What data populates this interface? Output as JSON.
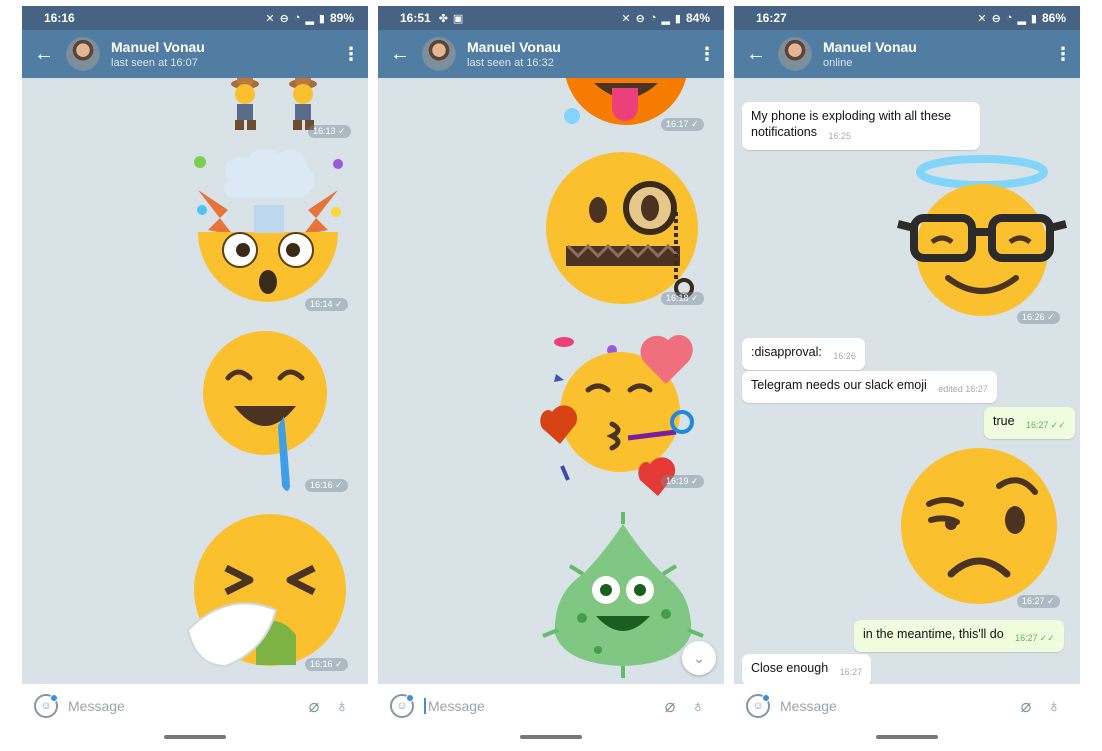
{
  "colors": {
    "header": "#527da3",
    "statusbar": "#466384",
    "chat_bg": "#d8e2e7",
    "outgoing_bubble": "#effdde",
    "emoji_yellow": "#fbc02d"
  },
  "screens": [
    {
      "status": {
        "time": "16:16",
        "battery": "89%"
      },
      "header": {
        "back_icon": "arrow-left-icon",
        "name": "Manuel Vonau",
        "subtitle": "last seen at 16:07",
        "menu_icon": "more-vertical-icon"
      },
      "stickers": [
        {
          "desc": "cowboy-emoji-sticker",
          "time": "16:13"
        },
        {
          "desc": "exploding-head-emoji-sticker",
          "time": "16:14"
        },
        {
          "desc": "drooling-face-emoji-sticker",
          "time": "16:16"
        },
        {
          "desc": "sneezing-face-emoji-sticker",
          "time": "16:16"
        }
      ],
      "input": {
        "placeholder": "Message"
      }
    },
    {
      "status": {
        "time": "16:51",
        "battery": "84%"
      },
      "header": {
        "back_icon": "arrow-left-icon",
        "name": "Manuel Vonau",
        "subtitle": "last seen at 16:32",
        "menu_icon": "more-vertical-icon"
      },
      "stickers": [
        {
          "desc": "tongue-out-emoji-sticker",
          "time": "16:17"
        },
        {
          "desc": "zipper-monocle-emoji-sticker",
          "time": "16:18"
        },
        {
          "desc": "kissing-hearts-party-emoji-sticker",
          "time": "16:19"
        },
        {
          "desc": "microbe-smile-emoji-sticker",
          "time": ""
        }
      ],
      "input": {
        "placeholder": "Message"
      }
    },
    {
      "status": {
        "time": "16:27",
        "battery": "86%"
      },
      "header": {
        "back_icon": "arrow-left-icon",
        "name": "Manuel Vonau",
        "subtitle": "online",
        "menu_icon": "more-vertical-icon"
      },
      "messages": [
        {
          "text": "My phone is exploding with all these notifications",
          "time": "16:25",
          "dir": "in"
        },
        {
          "text": ":disapproval:",
          "time": "16:26",
          "dir": "in"
        },
        {
          "text": "Telegram needs our slack emoji",
          "time": "edited 16:27",
          "dir": "in"
        },
        {
          "text": "true",
          "time": "16:27",
          "dir": "out"
        },
        {
          "text": "in the meantime, this'll do",
          "time": "16:27",
          "dir": "out"
        },
        {
          "text": "Close enough",
          "time": "16:27",
          "dir": "in"
        }
      ],
      "stickers": [
        {
          "desc": "halo-glasses-smile-emoji-sticker",
          "time": "16:26"
        },
        {
          "desc": "raised-eyebrow-frown-emoji-sticker",
          "time": "16:27"
        }
      ],
      "input": {
        "placeholder": "Message"
      }
    }
  ]
}
